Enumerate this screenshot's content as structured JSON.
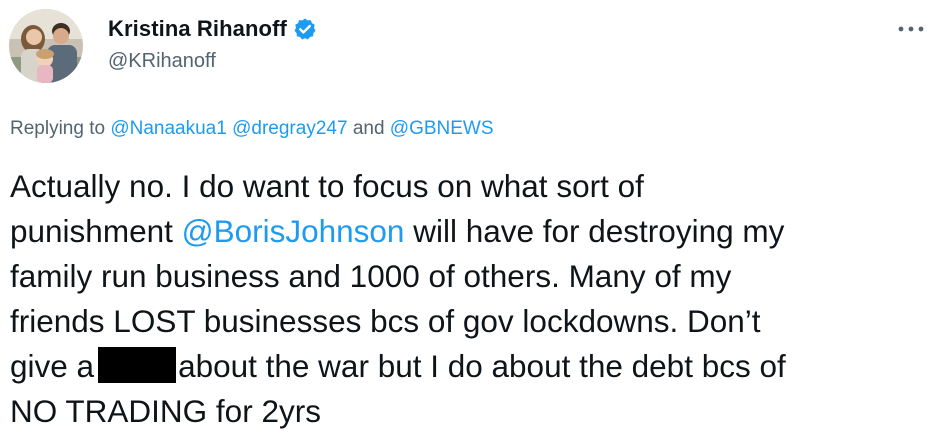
{
  "author": {
    "display_name": "Kristina Rihanoff",
    "handle": "@KRihanoff",
    "verified": true,
    "verified_icon": "verified-badge-icon",
    "avatar_icon": "profile-photo-avatar"
  },
  "header": {
    "more_icon": "more-options-icon"
  },
  "replying": {
    "prefix": "Replying to",
    "mention_1": "@Nanaakua1",
    "mention_2": "@dregray247",
    "conjunction": "and",
    "mention_3": "@GBNEWS"
  },
  "tweet": {
    "line1": "Actually no. I do want to focus on what sort of",
    "line2_pre": "punishment ",
    "line2_mention": "@BorisJohnson",
    "line2_post": " will have for destroying my",
    "line3": "family run business and 1000 of others. Many of my",
    "line4": "friends LOST businesses bcs of gov lockdowns. Don’t",
    "line5_pre": "give a",
    "line5_post": "about the war but I do about the debt bcs of",
    "line6": "NO TRADING for 2yrs"
  },
  "colors": {
    "text": "#0f1419",
    "secondary": "#536471",
    "link": "#1d9bf0",
    "verified": "#1d9bf0",
    "redaction": "#000000"
  }
}
